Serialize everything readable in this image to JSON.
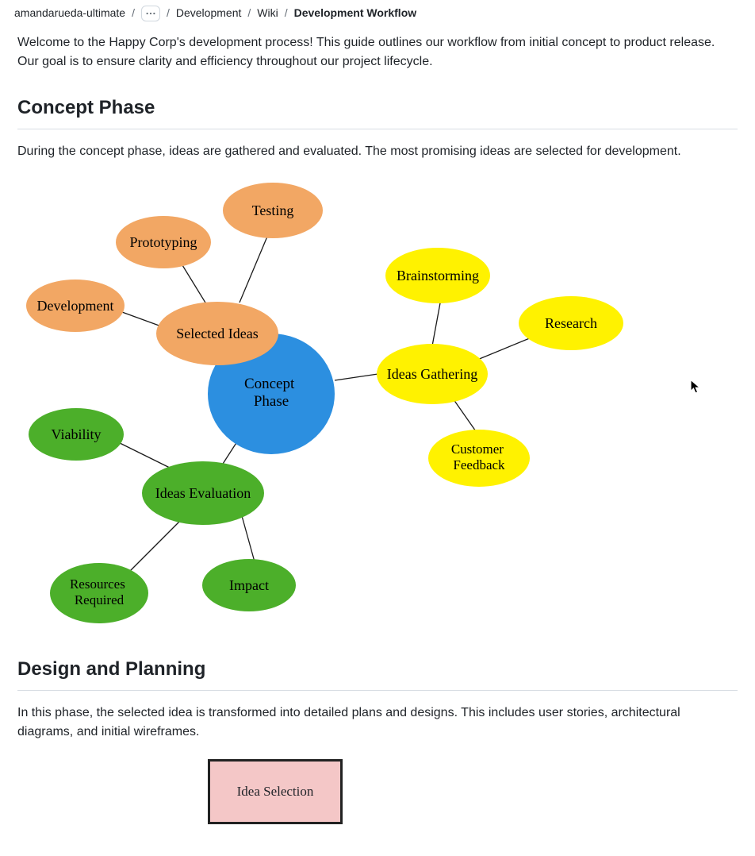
{
  "breadcrumb": {
    "root": "amandarueda-ultimate",
    "project": "Development",
    "section": "Wiki",
    "page": "Development Workflow"
  },
  "intro": "Welcome to the Happy Corp's development process! This guide outlines our workflow from initial concept to product release. Our goal is to ensure clarity and efficiency throughout our project lifecycle.",
  "sections": {
    "concept": {
      "heading": "Concept Phase",
      "text": "During the concept phase, ideas are gathered and evaluated. The most promising ideas are selected for development."
    },
    "design": {
      "heading": "Design and Planning",
      "text": "In this phase, the selected idea is transformed into detailed plans and designs. This includes user stories, architectural diagrams, and initial wireframes."
    }
  },
  "mindmap": {
    "root": "Concept\nPhase",
    "branches": {
      "selected_ideas": {
        "label": "Selected Ideas",
        "children": {
          "prototyping": "Prototyping",
          "testing": "Testing",
          "development": "Development"
        }
      },
      "ideas_gathering": {
        "label": "Ideas Gathering",
        "children": {
          "brainstorming": "Brainstorming",
          "research": "Research",
          "customer_feedback": "Customer\nFeedback"
        }
      },
      "ideas_evaluation": {
        "label": "Ideas Evaluation",
        "children": {
          "viability": "Viability",
          "resources_required": "Resources\nRequired",
          "impact": "Impact"
        }
      }
    }
  },
  "colors": {
    "root": "#2c8fe0",
    "orange": "#f2a764",
    "yellow": "#fff200",
    "green": "#4caf2a"
  },
  "design_box": {
    "label": "Idea Selection"
  }
}
